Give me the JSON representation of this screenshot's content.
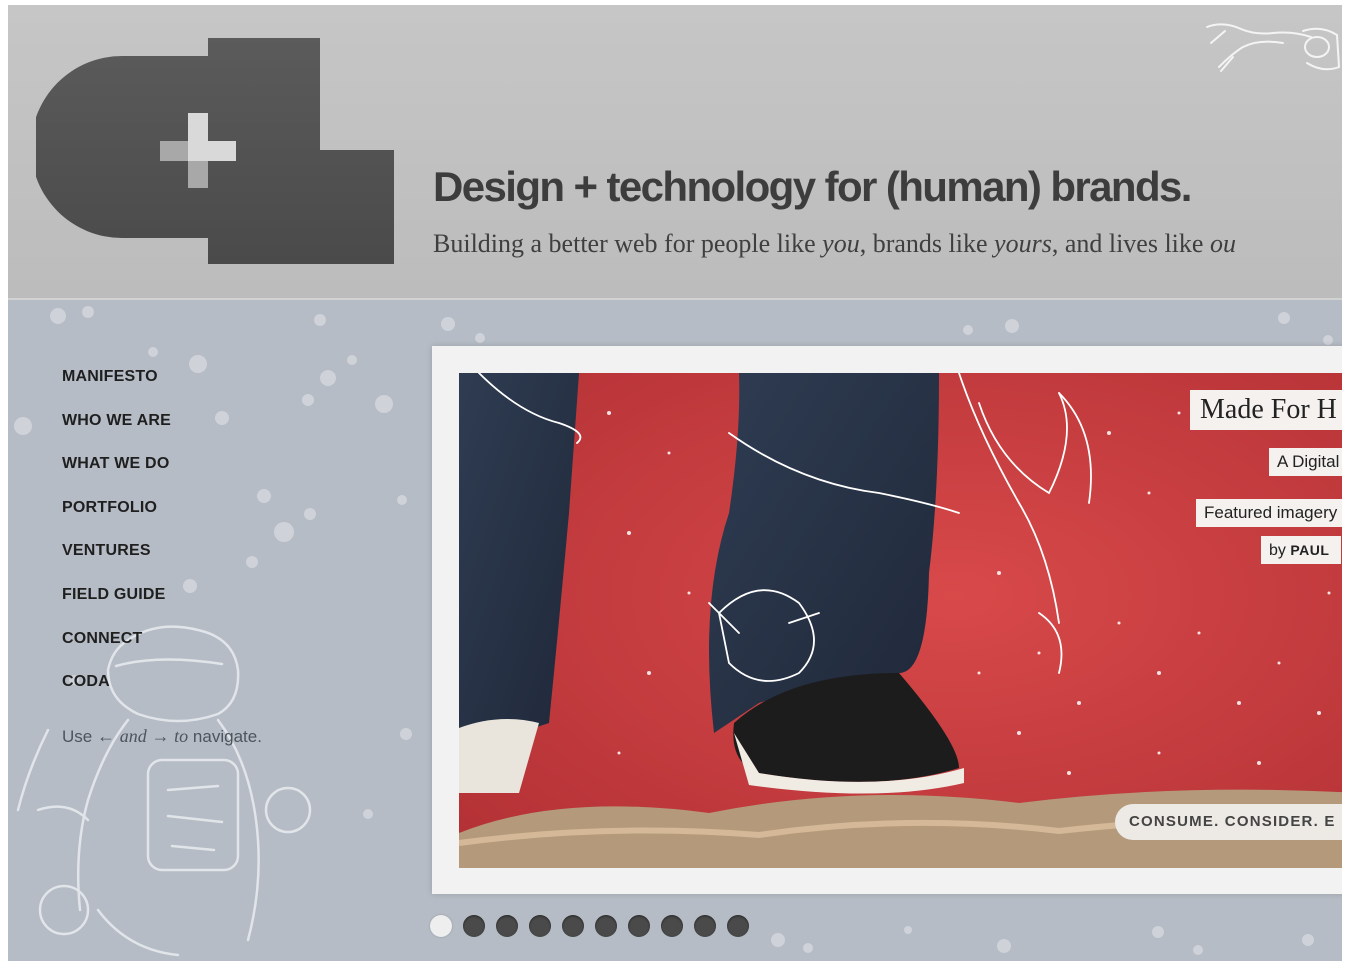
{
  "header": {
    "logo_alt": "d+",
    "tagline": "Design + technology for (human) brands.",
    "subline": {
      "part1": "Building a better web for people like ",
      "em1": "you",
      "part2": ", brands like ",
      "em2": "yours",
      "part3": ", and lives like ",
      "em3": "ou"
    }
  },
  "nav": {
    "items": [
      "MANIFESTO",
      "WHO WE ARE",
      "WHAT WE DO",
      "PORTFOLIO",
      "VENTURES",
      "FIELD GUIDE",
      "CONNECT",
      "CODA"
    ],
    "hint": {
      "use": "Use",
      "left_arrow": "←",
      "and": "and",
      "right_arrow": "→",
      "to": "to",
      "navigate": "navigate."
    }
  },
  "slide": {
    "title": "Made For H",
    "subtitle": "A Digital",
    "featured": "Featured imagery",
    "by_label": "by",
    "by_name": "PAUL",
    "cta": "CONSUME. CONSIDER. E"
  },
  "pager": {
    "count": 10,
    "active_index": 0
  },
  "colors": {
    "header_bg": "#c2c2c2",
    "content_bg": "#b5bcc5",
    "slide_red": "#c63a3c",
    "text_dark": "#3d3d3d"
  }
}
